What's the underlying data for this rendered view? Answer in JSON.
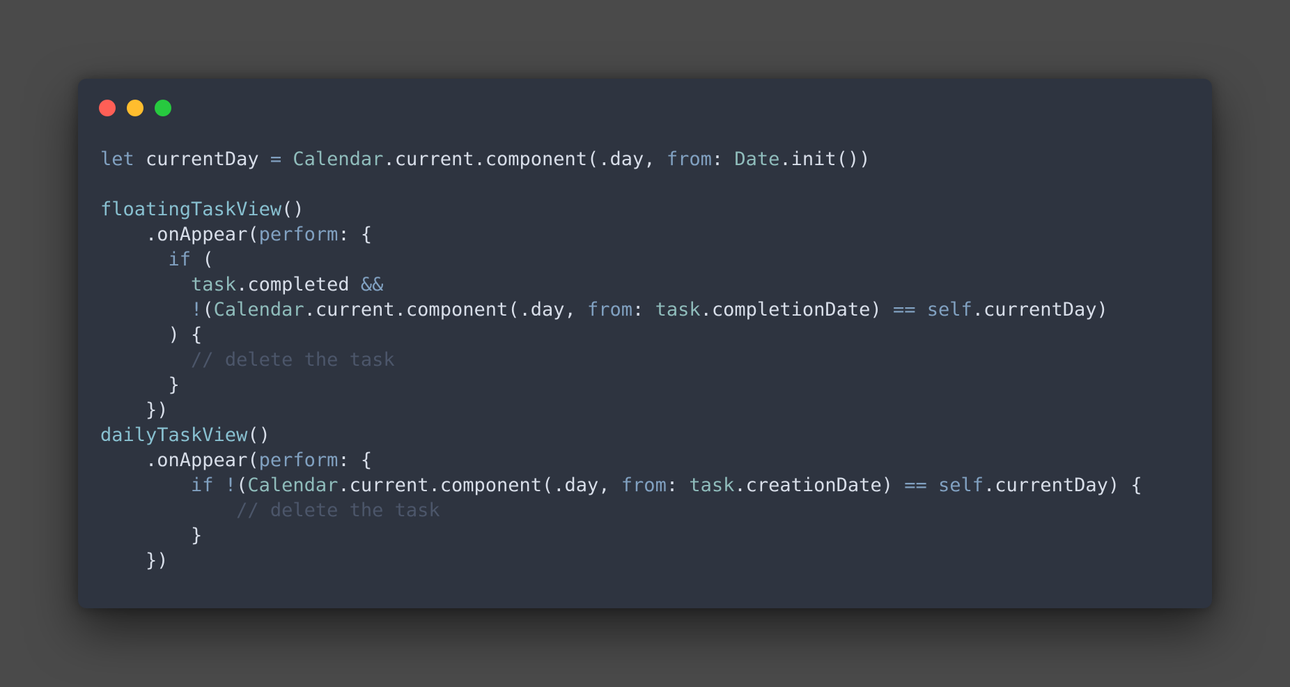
{
  "window": {
    "traffic_lights": [
      {
        "name": "close",
        "color": "#ff5f56"
      },
      {
        "name": "minimize",
        "color": "#ffbd2e"
      },
      {
        "name": "zoom",
        "color": "#27c93f"
      }
    ]
  },
  "colors": {
    "background": "#4a4a4a",
    "editor_background": "#2e3440",
    "keyword": "#81a1c1",
    "type": "#8fbcbb",
    "function": "#88c0d0",
    "text": "#d8dee9",
    "comment": "#4c566a"
  },
  "code_lines": [
    [
      {
        "t": "let",
        "c": "kw"
      },
      {
        "t": " currentDay ",
        "c": "plain"
      },
      {
        "t": "=",
        "c": "op"
      },
      {
        "t": " ",
        "c": "plain"
      },
      {
        "t": "Calendar",
        "c": "type"
      },
      {
        "t": ".current.component(.day, ",
        "c": "plain"
      },
      {
        "t": "from",
        "c": "label"
      },
      {
        "t": ": ",
        "c": "plain"
      },
      {
        "t": "Date",
        "c": "type"
      },
      {
        "t": ".init())",
        "c": "plain"
      }
    ],
    [],
    [
      {
        "t": "floatingTaskView",
        "c": "fn"
      },
      {
        "t": "()",
        "c": "plain"
      }
    ],
    [
      {
        "t": "    .onAppear(",
        "c": "plain"
      },
      {
        "t": "perform",
        "c": "label"
      },
      {
        "t": ": {",
        "c": "plain"
      }
    ],
    [
      {
        "t": "      ",
        "c": "plain"
      },
      {
        "t": "if",
        "c": "kw"
      },
      {
        "t": " (",
        "c": "plain"
      }
    ],
    [
      {
        "t": "        ",
        "c": "plain"
      },
      {
        "t": "task",
        "c": "var"
      },
      {
        "t": ".completed ",
        "c": "plain"
      },
      {
        "t": "&&",
        "c": "op"
      }
    ],
    [
      {
        "t": "        ",
        "c": "plain"
      },
      {
        "t": "!",
        "c": "op"
      },
      {
        "t": "(",
        "c": "plain"
      },
      {
        "t": "Calendar",
        "c": "type"
      },
      {
        "t": ".current.component(.day, ",
        "c": "plain"
      },
      {
        "t": "from",
        "c": "label"
      },
      {
        "t": ": ",
        "c": "plain"
      },
      {
        "t": "task",
        "c": "var"
      },
      {
        "t": ".completionDate) ",
        "c": "plain"
      },
      {
        "t": "==",
        "c": "op"
      },
      {
        "t": " ",
        "c": "plain"
      },
      {
        "t": "self",
        "c": "kw"
      },
      {
        "t": ".currentDay)",
        "c": "plain"
      }
    ],
    [
      {
        "t": "      ) {",
        "c": "plain"
      }
    ],
    [
      {
        "t": "        ",
        "c": "plain"
      },
      {
        "t": "// delete the task",
        "c": "comment"
      }
    ],
    [
      {
        "t": "      }",
        "c": "plain"
      }
    ],
    [
      {
        "t": "    })",
        "c": "plain"
      }
    ],
    [
      {
        "t": "dailyTaskView",
        "c": "fn"
      },
      {
        "t": "()",
        "c": "plain"
      }
    ],
    [
      {
        "t": "    .onAppear(",
        "c": "plain"
      },
      {
        "t": "perform",
        "c": "label"
      },
      {
        "t": ": {",
        "c": "plain"
      }
    ],
    [
      {
        "t": "        ",
        "c": "plain"
      },
      {
        "t": "if",
        "c": "kw"
      },
      {
        "t": " ",
        "c": "plain"
      },
      {
        "t": "!",
        "c": "op"
      },
      {
        "t": "(",
        "c": "plain"
      },
      {
        "t": "Calendar",
        "c": "type"
      },
      {
        "t": ".current.component(.day, ",
        "c": "plain"
      },
      {
        "t": "from",
        "c": "label"
      },
      {
        "t": ": ",
        "c": "plain"
      },
      {
        "t": "task",
        "c": "var"
      },
      {
        "t": ".creationDate) ",
        "c": "plain"
      },
      {
        "t": "==",
        "c": "op"
      },
      {
        "t": " ",
        "c": "plain"
      },
      {
        "t": "self",
        "c": "kw"
      },
      {
        "t": ".currentDay) {",
        "c": "plain"
      }
    ],
    [
      {
        "t": "            ",
        "c": "plain"
      },
      {
        "t": "// delete the task",
        "c": "comment"
      }
    ],
    [
      {
        "t": "        }",
        "c": "plain"
      }
    ],
    [
      {
        "t": "    })",
        "c": "plain"
      }
    ]
  ]
}
